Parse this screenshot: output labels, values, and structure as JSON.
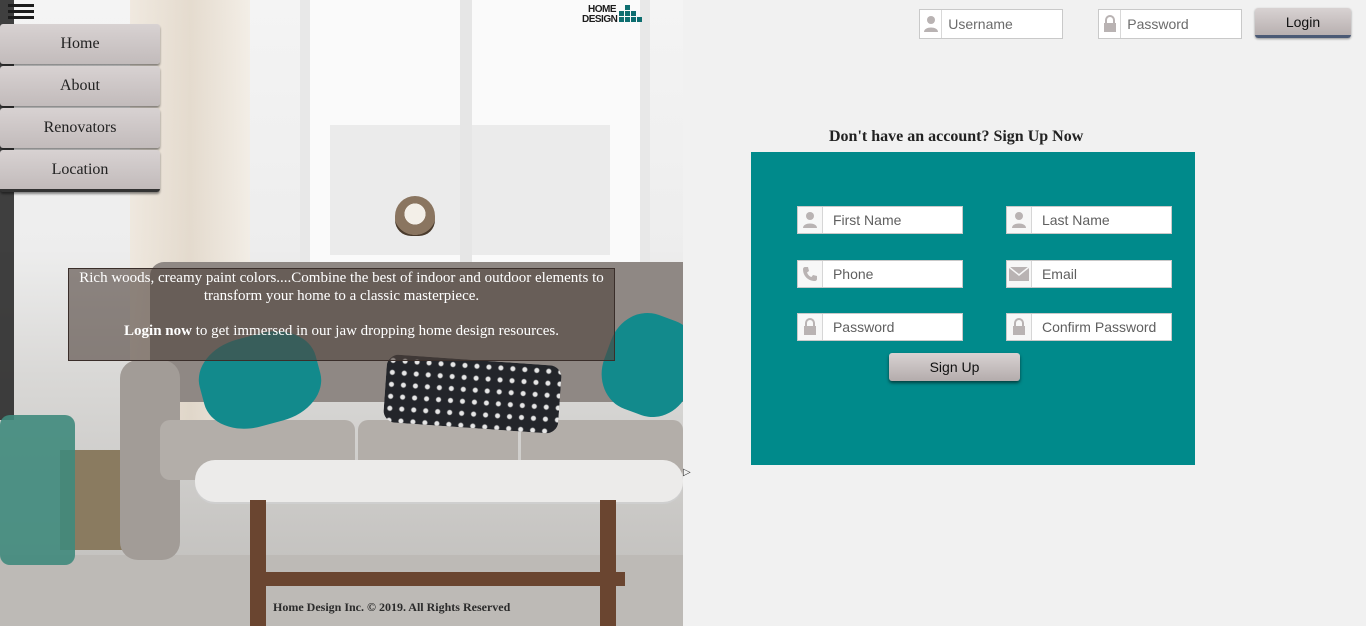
{
  "logo": {
    "line1": "HOME",
    "line2": "DESIGN"
  },
  "nav": {
    "items": [
      {
        "label": "Home"
      },
      {
        "label": "About"
      },
      {
        "label": "Renovators"
      },
      {
        "label": "Location"
      }
    ]
  },
  "hero": {
    "tagline": "Rich woods, creamy paint colors....Combine the best of indoor and outdoor elements to transform your home to a classic masterpiece.",
    "login_bold": "Login now",
    "login_rest": " to get immersed in our jaw dropping home design resources."
  },
  "footer": {
    "text": "Home Design Inc. © 2019. All Rights Reserved"
  },
  "login": {
    "username_placeholder": "Username",
    "password_placeholder": "Password",
    "button_label": "Login"
  },
  "signup": {
    "title": "Don't have an account? Sign Up Now",
    "first_name_placeholder": "First Name",
    "last_name_placeholder": "Last Name",
    "phone_placeholder": "Phone",
    "email_placeholder": "Email",
    "password_placeholder": "Password",
    "confirm_password_placeholder": "Confirm Password",
    "button_label": "Sign Up"
  },
  "colors": {
    "signup_bg": "#008a8b",
    "page_bg": "#f1f1f1",
    "button_grad_top": "#d8d2d2",
    "icon_gray": "#b9b3b3"
  },
  "icons": [
    "menu-icon",
    "user-icon",
    "lock-icon",
    "phone-icon",
    "envelope-icon"
  ]
}
